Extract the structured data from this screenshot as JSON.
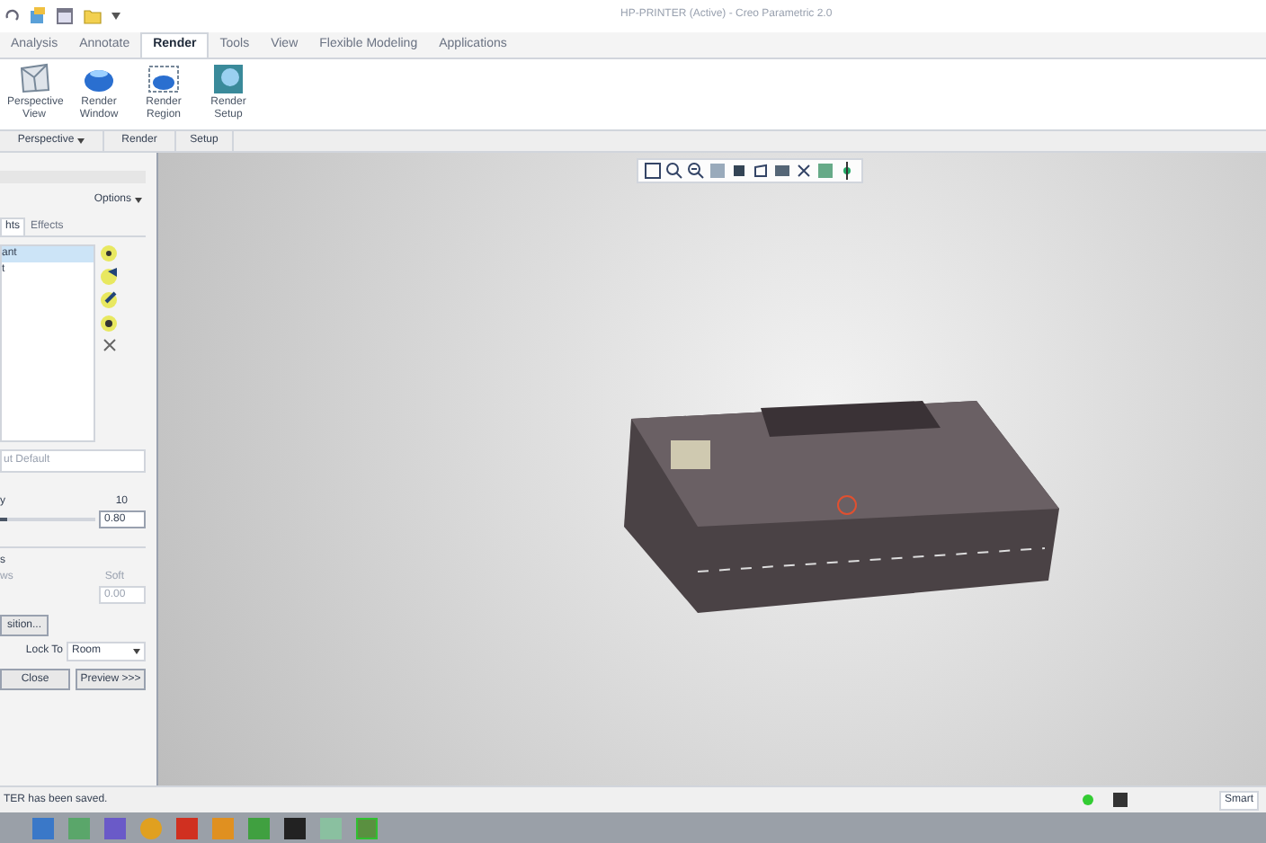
{
  "window": {
    "title": "HP-PRINTER (Active) - Creo Parametric 2.0"
  },
  "ribbon_tabs": [
    {
      "label": "Analysis",
      "selected": false
    },
    {
      "label": "Annotate",
      "selected": false
    },
    {
      "label": "Render",
      "selected": true
    },
    {
      "label": "Tools",
      "selected": false
    },
    {
      "label": "View",
      "selected": false
    },
    {
      "label": "Flexible Modeling",
      "selected": false
    },
    {
      "label": "Applications",
      "selected": false
    }
  ],
  "ribbon_buttons": [
    {
      "label": "Perspective View",
      "kind": "perspective"
    },
    {
      "label": "Render Window",
      "kind": "window"
    },
    {
      "label": "Render Region",
      "kind": "region"
    },
    {
      "label": "Render Setup",
      "kind": "setup"
    }
  ],
  "ribbon_groups": [
    {
      "label": "Perspective",
      "dropdown": true
    },
    {
      "label": "Render",
      "dropdown": false
    },
    {
      "label": "Setup",
      "dropdown": false
    }
  ],
  "panel": {
    "options": "Options",
    "tabs": [
      {
        "label": "hts",
        "selected": true
      },
      {
        "label": "Effects",
        "selected": false
      }
    ],
    "lights": [
      {
        "label": "ant",
        "selected": true
      },
      {
        "label": "t",
        "selected": false
      }
    ],
    "name_field": "ut Default",
    "slider": {
      "label": "y",
      "max": "10",
      "value": "0.80",
      "level": 0.08
    },
    "shadow_label": "s",
    "shadow_label_2": "ws",
    "soft_label": "Soft",
    "soft_value": "0.00",
    "position_button": "sition...",
    "lock_label": "Lock To",
    "lock_value": "Room",
    "close": "Close",
    "preview": "Preview >>>"
  },
  "status_bar": {
    "message": "TER has been saved.",
    "filter": "Smart"
  }
}
